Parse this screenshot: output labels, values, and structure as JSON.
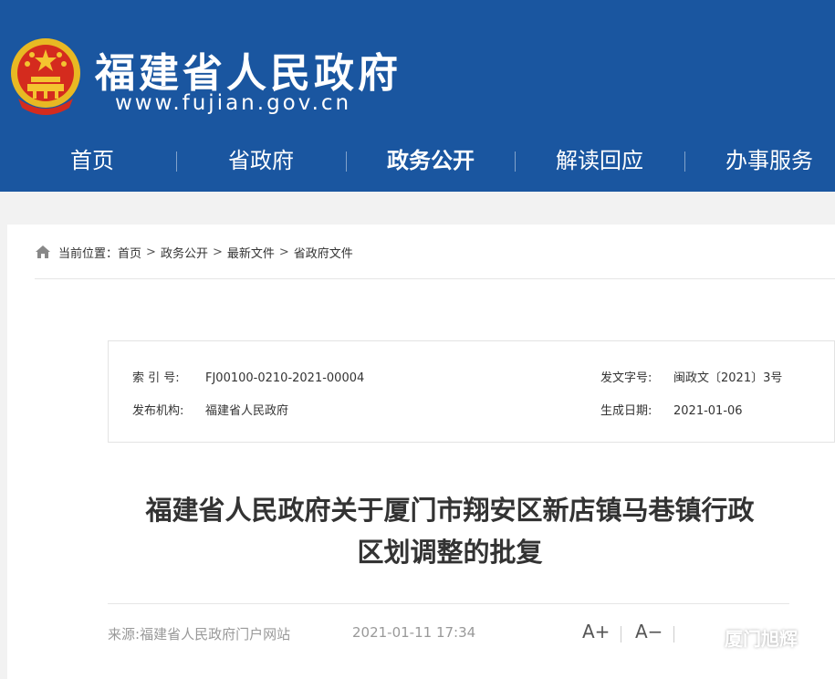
{
  "header": {
    "site_title": "福建省人民政府",
    "site_url": "www.fujian.gov.cn",
    "brand_color": "#1a56a0"
  },
  "nav": {
    "items": [
      {
        "label": "首页",
        "active": false
      },
      {
        "label": "省政府",
        "active": false
      },
      {
        "label": "政务公开",
        "active": true
      },
      {
        "label": "解读回应",
        "active": false
      },
      {
        "label": "办事服务",
        "active": false
      }
    ]
  },
  "breadcrumb": {
    "prefix": "当前位置：",
    "items": [
      "首页",
      "政务公开",
      "最新文件",
      "省政府文件"
    ],
    "separator": ">"
  },
  "meta": {
    "index_label": "索 引 号:",
    "index_value": "FJ00100-0210-2021-00004",
    "doc_no_label": "发文字号:",
    "doc_no_value": "闽政文〔2021〕3号",
    "publisher_label": "发布机构:",
    "publisher_value": "福建省人民政府",
    "created_label": "生成日期:",
    "created_value": "2021-01-06"
  },
  "document": {
    "title_line1": "福建省人民政府关于厦门市翔安区新店镇马巷镇行政",
    "title_line2": "区划调整的批复",
    "source_label": "来源:",
    "source_value": "福建省人民政府门户网站",
    "publish_datetime": "2021-01-11 17:34"
  },
  "toolbar": {
    "font_increase": "A+",
    "font_decrease": "A−"
  },
  "watermark": {
    "text": "厦门旭辉",
    "icon": "wechat-icon"
  }
}
